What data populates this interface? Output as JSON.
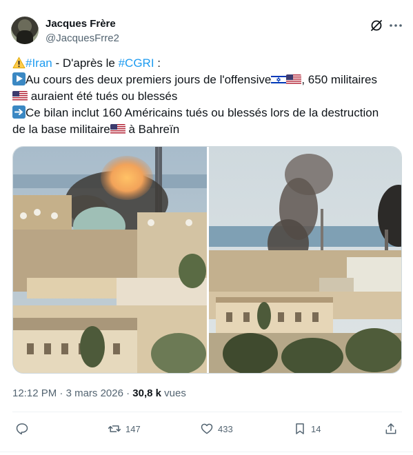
{
  "author": {
    "name": "Jacques Frère",
    "handle": "@JacquesFrre2"
  },
  "icons": {
    "grok": "grok-icon",
    "more": "more-icon"
  },
  "text": {
    "line1_hashtag1": "#Iran",
    "line1_mid": " - D'après le ",
    "line1_hashtag2": "#CGRI",
    "line1_end": " :",
    "line2_a": "Au cours des deux premiers jours de l'offensive",
    "line2_b": ", 650 militaires",
    "line3": " auraient été tués ou blessés",
    "line4": "Ce bilan inclut 160 Américains tués ou blessés lors de la destruction",
    "line5_a": "de la base militaire",
    "line5_b": " à Bahreïn"
  },
  "media": {
    "images": [
      "explosion-left",
      "smoke-right"
    ]
  },
  "meta": {
    "time": "12:12 PM",
    "sep1": " · ",
    "date": "3 mars 2026",
    "sep2": " · ",
    "views_count": "30,8 k",
    "views_label": " vues"
  },
  "actions": {
    "reply_count": "",
    "retweet_count": "147",
    "like_count": "433",
    "bookmark_count": "14"
  },
  "colors": {
    "link": "#1d9bf0",
    "muted": "#536471",
    "text": "#0f1419"
  }
}
